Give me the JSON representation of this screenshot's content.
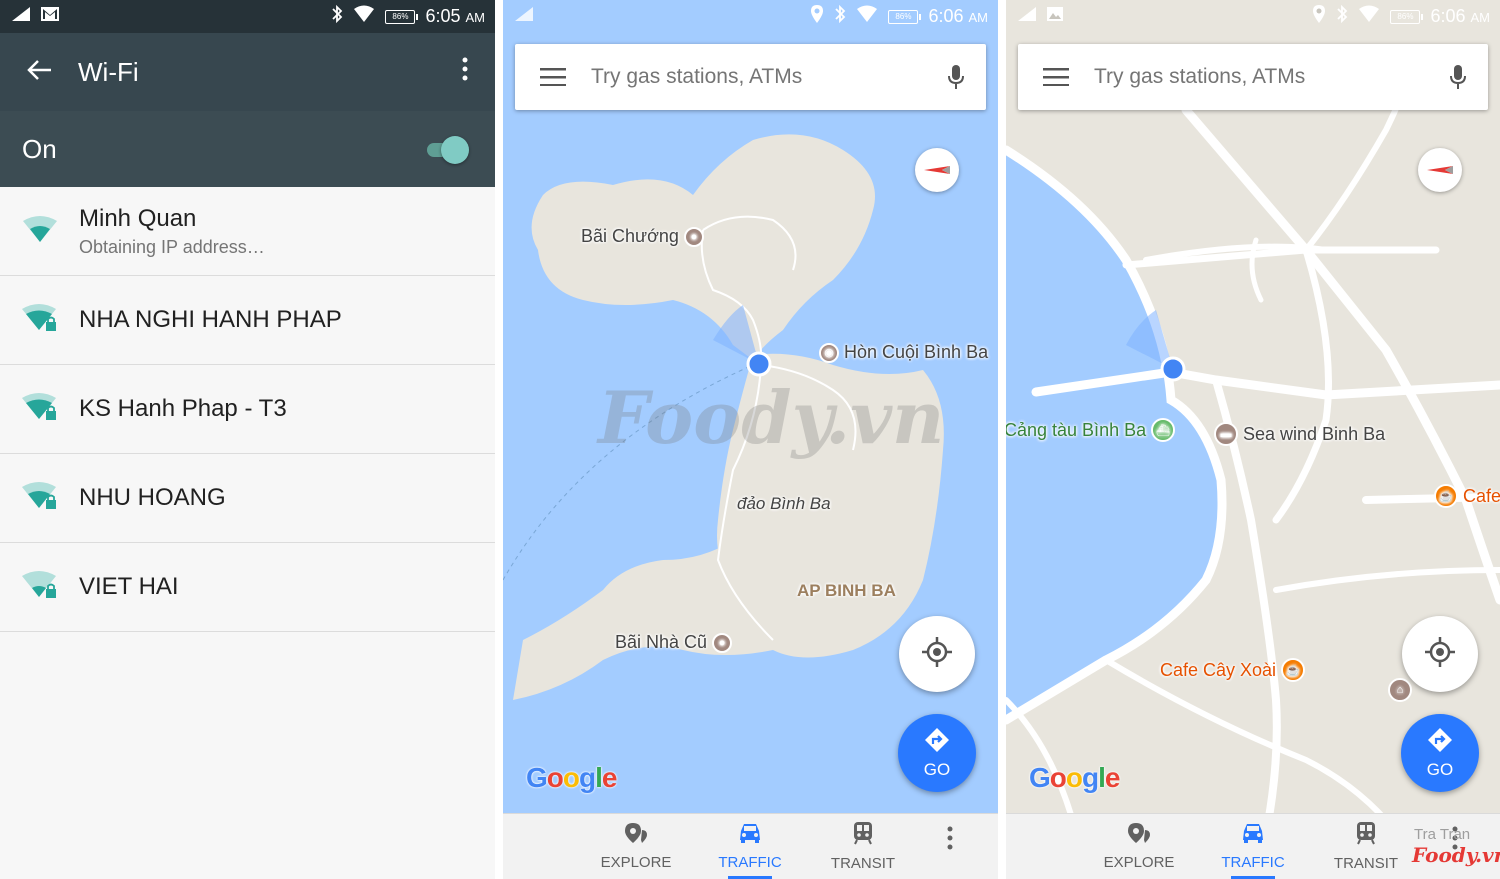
{
  "colors": {
    "accent": "#2979ff",
    "wifi_header": "#37474f",
    "toggle": "#80cbc4",
    "water": "#a3ccff",
    "land": "#e8e5dd"
  },
  "wifi": {
    "status_time": "6:05",
    "status_ampm": "AM",
    "battery": "86%",
    "title": "Wi-Fi",
    "toggle_label": "On",
    "networks": [
      {
        "ssid": "Minh Quan",
        "status": "Obtaining IP address…"
      },
      {
        "ssid": "NHA NGHI HANH PHAP",
        "status": ""
      },
      {
        "ssid": "KS Hanh Phap - T3",
        "status": ""
      },
      {
        "ssid": "NHU HOANG",
        "status": ""
      },
      {
        "ssid": "VIET HAI",
        "status": ""
      }
    ]
  },
  "map1": {
    "status_time": "6:06",
    "status_ampm": "AM",
    "battery": "86%",
    "search_placeholder": "Try gas stations, ATMs",
    "places": {
      "bai_chuong": "Bãi Chướng",
      "hon_cuoi": "Hòn Cuội Bình Ba",
      "dao_binh_ba": "đảo Bình Ba",
      "ap_binh_ba": "AP BINH BA",
      "bai_nha_cu": "Bãi Nhà Cũ"
    },
    "watermark": "Foody.vn",
    "google": [
      "G",
      "o",
      "o",
      "g",
      "l",
      "e"
    ],
    "go_label": "GO",
    "nav": {
      "explore": "EXPLORE",
      "traffic": "TRAFFIC",
      "transit": "TRANSIT"
    }
  },
  "map2": {
    "status_time": "6:06",
    "status_ampm": "AM",
    "battery": "86%",
    "search_placeholder": "Try gas stations, ATMs",
    "places": {
      "cang_tau": "Cảng tàu Bình Ba",
      "sea_wind": "Sea wind Binh Ba",
      "cafe": "Cafe",
      "cafe_cay_xoai": "Cafe Cây Xoài"
    },
    "google": [
      "G",
      "o",
      "o",
      "g",
      "l",
      "e"
    ],
    "go_label": "GO",
    "nav": {
      "explore": "EXPLORE",
      "traffic": "TRAFFIC",
      "transit": "TRANSIT"
    },
    "credit_name": "Tra Tran",
    "credit_brand": "Foody.vn"
  }
}
